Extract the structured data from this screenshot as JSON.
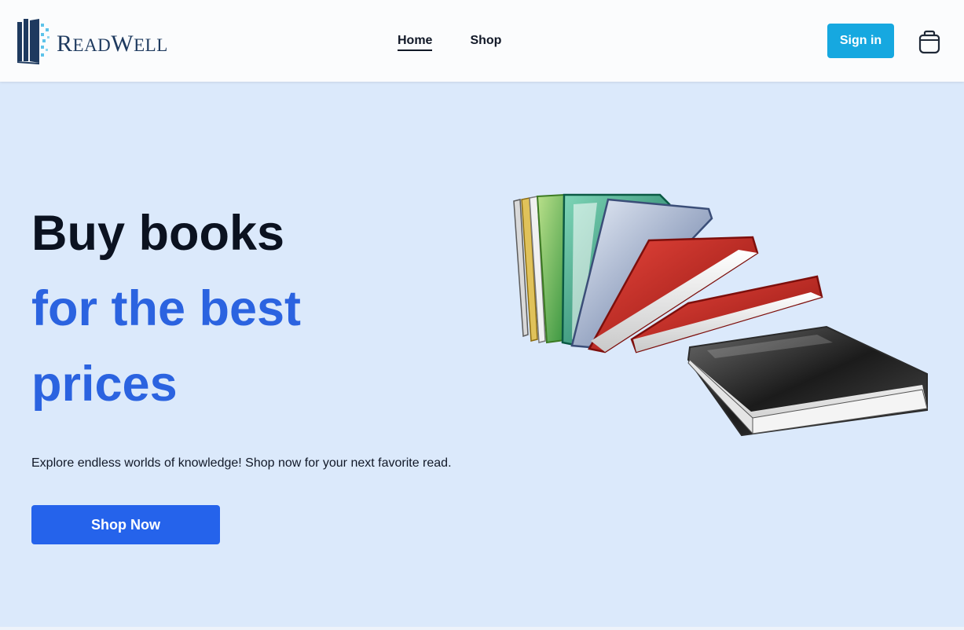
{
  "brand": {
    "name_first": "R",
    "name_rest": "EAD",
    "name_second": "W",
    "name_rest2": "ELL"
  },
  "nav": {
    "items": [
      {
        "label": "Home"
      },
      {
        "label": "Shop"
      }
    ]
  },
  "header": {
    "signin_label": "Sign in",
    "cart_icon": "shopping-bag-icon"
  },
  "hero": {
    "title_line1": "Buy books",
    "title_line2": "for the best",
    "title_line3": "prices",
    "description": "Explore endless worlds of knowledge! Shop now for your next favorite read.",
    "cta_label": "Shop Now",
    "illustration": "books-illustration"
  },
  "colors": {
    "accent": "#2563eb",
    "signin": "#16a8e0",
    "background": "#dbe9fb",
    "title_dark": "#0b1220",
    "title_blue": "#2b63e0"
  }
}
